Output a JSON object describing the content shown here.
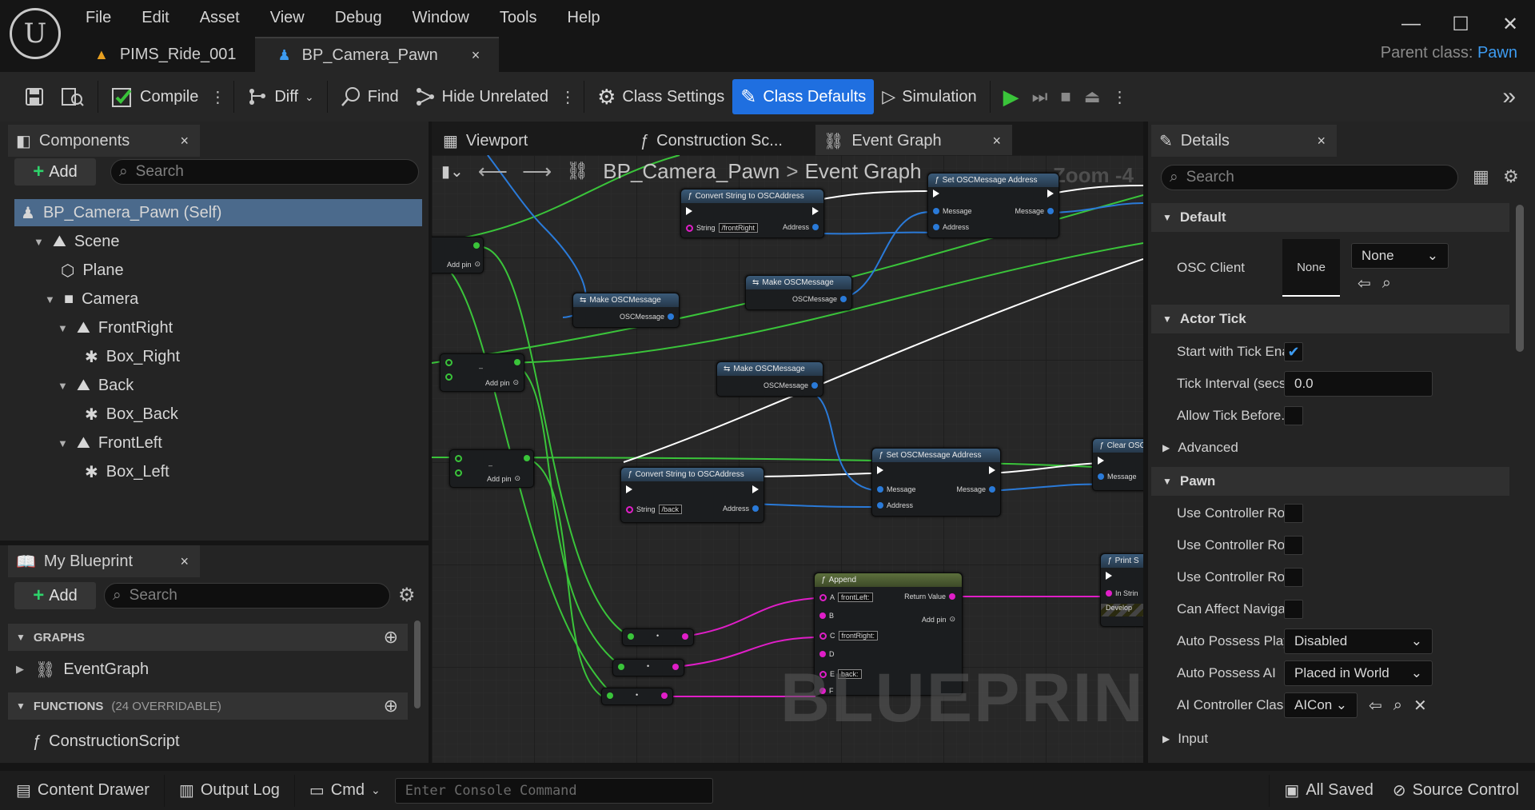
{
  "menu": [
    "File",
    "Edit",
    "Asset",
    "View",
    "Debug",
    "Window",
    "Tools",
    "Help"
  ],
  "doc_tabs": [
    {
      "label": "PIMS_Ride_001"
    },
    {
      "label": "BP_Camera_Pawn",
      "close": "×"
    }
  ],
  "parent_class": {
    "label": "Parent class:",
    "value": "Pawn"
  },
  "window_controls": {
    "minimize": "—",
    "maximize": "☐",
    "close": "✕"
  },
  "toolbar": {
    "compile": "Compile",
    "diff": "Diff",
    "find": "Find",
    "hide_unrelated": "Hide Unrelated",
    "class_settings": "Class Settings",
    "class_defaults": "Class Defaults",
    "simulation": "Simulation"
  },
  "components": {
    "tab": "Components",
    "close": "×",
    "add": "Add",
    "search_placeholder": "Search",
    "tree": [
      {
        "label": "BP_Camera_Pawn (Self)"
      },
      {
        "label": "Scene"
      },
      {
        "label": "Plane"
      },
      {
        "label": "Camera"
      },
      {
        "label": "FrontRight"
      },
      {
        "label": "Box_Right"
      },
      {
        "label": "Back"
      },
      {
        "label": "Box_Back"
      },
      {
        "label": "FrontLeft"
      },
      {
        "label": "Box_Left"
      }
    ]
  },
  "my_blueprint": {
    "tab": "My Blueprint",
    "close": "×",
    "add": "Add",
    "search_placeholder": "Search",
    "graphs_header": "GRAPHS",
    "event_graph": "EventGraph",
    "functions_header": "FUNCTIONS",
    "functions_count": "(24 OVERRIDABLE)",
    "construction_script": "ConstructionScript"
  },
  "center_tabs": [
    {
      "label": "Viewport"
    },
    {
      "label": "Construction Sc..."
    },
    {
      "label": "Event Graph",
      "close": "×"
    }
  ],
  "graph": {
    "breadcrumb_root": "BP_Camera_Pawn",
    "breadcrumb_sep": ">",
    "breadcrumb_leaf": "Event Graph",
    "zoom": "Zoom -4",
    "watermark": "BLUEPRINT",
    "nodes": {
      "convert1": {
        "title": "Convert String to OSCAddress",
        "string_label": "String",
        "string_value": "/frontRight",
        "out": "Address"
      },
      "setaddr_top": {
        "title": "Set OSCMessage Address",
        "in": "Message",
        "out": "Message",
        "addr": "Address"
      },
      "addpin": "Add pin",
      "make1": {
        "title": "Make OSCMessage",
        "out": "OSCMessage"
      },
      "make2": {
        "title": "Make OSCMessage",
        "out": "OSCMessage"
      },
      "make3": {
        "title": "Make OSCMessage",
        "out": "OSCMessage"
      },
      "convert2": {
        "title": "Convert String to OSCAddress",
        "string_label": "String",
        "string_value": "/back",
        "out": "Address"
      },
      "setaddr": {
        "title": "Set OSCMessage Address",
        "in": "Message",
        "out": "Message",
        "addr": "Address"
      },
      "clear": {
        "title": "Clear OSC",
        "in": "Message"
      },
      "append": {
        "title": "Append",
        "a": "A",
        "a_val": "frontLeft:",
        "b": "B",
        "c": "C",
        "c_val": "frontRight:",
        "d": "D",
        "e": "E",
        "e_val": "back:",
        "f": "F",
        "ret": "Return Value",
        "addpin": "Add pin"
      },
      "print": {
        "title": "Print S",
        "in": "In Strin",
        "dev": "Develop"
      }
    }
  },
  "details": {
    "tab": "Details",
    "close": "×",
    "search_placeholder": "Search",
    "default_header": "Default",
    "osc_client_label": "OSC Client",
    "osc_client_thumb": "None",
    "osc_client_value": "None",
    "actor_tick_header": "Actor Tick",
    "start_tick_label": "Start with Tick Ena...",
    "start_tick_checked": true,
    "tick_interval_label": "Tick Interval (secs)",
    "tick_interval_value": "0.0",
    "allow_tick_label": "Allow Tick Before...",
    "advanced": "Advanced",
    "pawn_header": "Pawn",
    "use_rot1": "Use Controller Rot...",
    "use_rot2": "Use Controller Rot...",
    "use_rot3": "Use Controller Rot...",
    "can_affect": "Can Affect Navigat...",
    "auto_possess_player_label": "Auto Possess Player",
    "auto_possess_player_value": "Disabled",
    "auto_possess_ai_label": "Auto Possess AI",
    "auto_possess_ai_value": "Placed in World",
    "ai_controller_label": "AI Controller Class",
    "ai_controller_value": "AICon",
    "input": "Input"
  },
  "statusbar": {
    "content_drawer": "Content Drawer",
    "output_log": "Output Log",
    "cmd": "Cmd",
    "console_placeholder": "Enter Console Command",
    "all_saved": "All Saved",
    "source_control": "Source Control"
  },
  "colors": {
    "accent": "#1f6fe0",
    "link": "#3d9bf0",
    "exec_wire": "#ffffff",
    "float_wire": "#3ac43a",
    "string_wire": "#e01ec8",
    "struct_wire": "#2a7ad8"
  }
}
